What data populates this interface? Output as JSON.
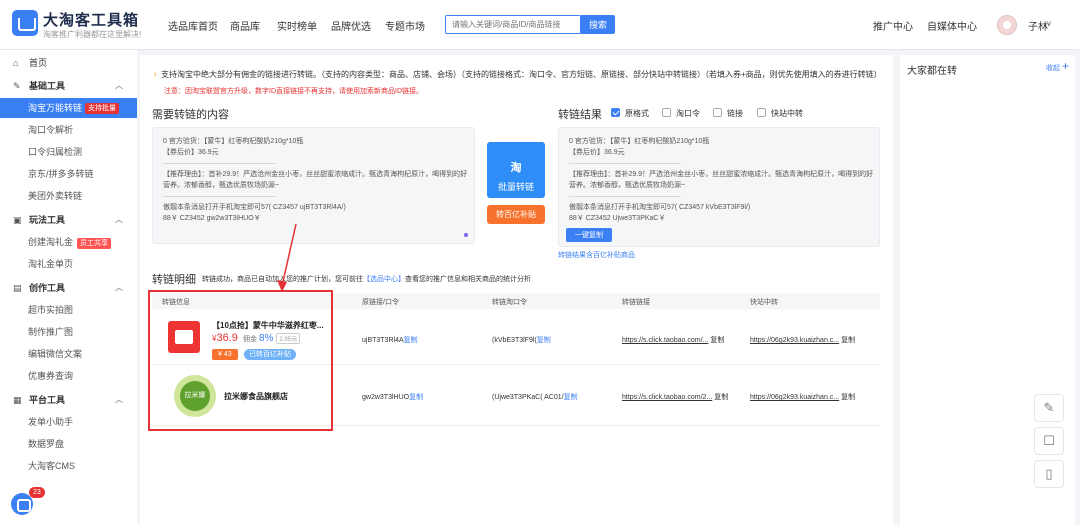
{
  "header": {
    "logo_title": "大淘客工具箱",
    "logo_subtitle": "淘客推广利器都在这里解决!",
    "nav": [
      "选品库首页",
      "商品库",
      "实时榜单",
      "品牌优选",
      "专题市场"
    ],
    "search_placeholder": "请输入关键词/商品ID/商品链接",
    "search_button": "搜索",
    "right_nav": [
      "推广中心",
      "自媒体中心"
    ],
    "username": "子林",
    "caret": "∨"
  },
  "sidebar": {
    "home": "首页",
    "sections": [
      {
        "title": "基础工具",
        "items": [
          {
            "label": "淘宝万能转链",
            "tag": "支持批量",
            "active": true
          },
          {
            "label": "淘口令解析"
          },
          {
            "label": "口令归属检测"
          },
          {
            "label": "京东/拼多多转链"
          },
          {
            "label": "美团外卖转链"
          }
        ]
      },
      {
        "title": "玩法工具",
        "items": [
          {
            "label": "创建淘礼金",
            "tag": "员工共享"
          },
          {
            "label": "淘礼金单页"
          }
        ]
      },
      {
        "title": "创作工具",
        "items": [
          {
            "label": "超市实拍图"
          },
          {
            "label": "制作推广图"
          },
          {
            "label": "编辑微信文案"
          },
          {
            "label": "优惠券查询"
          }
        ]
      },
      {
        "title": "平台工具",
        "items": [
          {
            "label": "发单小助手"
          },
          {
            "label": "数据罗盘"
          },
          {
            "label": "大淘客CMS"
          }
        ]
      }
    ],
    "assistant_badge": "23"
  },
  "main": {
    "notice": "支持淘宝中绝大部分有佣金的链接进行转链。（支持的内容类型：商品、店铺、会场）（支持的链接格式：淘口令、官方短链、原链接、部分快站中转链接）（若填入券+商品，则优先使用填入的券进行转链）",
    "warning": "注意：因淘宝联盟官方升级，数字ID直接链接不再支持，请使用加索新商品ID链接。",
    "input_title": "需要转链的内容",
    "input_lines": [
      "0 官方验货：【蒙牛】红枣枸杞酸奶210g*10瓶",
      "【券后价】36.9元",
      "————————————————",
      "【推荐理由】：首补29.9！严选沧州金丝小枣，丝丝甜蜜浓缩成汁。甄选青海枸杞原汁，喝得到的好",
      "营养。浓郁香醇，甄选优质牧场奶源~",
      "————————————————",
      "傲靓本条消息打开手机淘宝即可57( CZ3457 ujBT3T3Rl4A/)",
      "88￥ CZ3452 gw2w3T3lHUO￥"
    ],
    "convert_icon": "淘",
    "convert_button": "批量转链",
    "orange_button": "转百亿补贴",
    "result_title": "转链结果",
    "options": [
      {
        "label": "原格式",
        "checked": true
      },
      {
        "label": "淘口令",
        "checked": false
      },
      {
        "label": "链接",
        "checked": false
      },
      {
        "label": "快站中转",
        "checked": false
      }
    ],
    "result_lines": [
      "0 官方验货：【蒙牛】红枣枸杞酸奶210g*10瓶",
      "【券后价】36.9元",
      "————————————————",
      "【推荐理由】：首补29.9！严选沧州金丝小枣，丝丝甜蜜浓缩成汁。甄选青海枸杞原汁，喝得到的好",
      "营养。浓郁香醇，甄选优质牧场奶源~",
      "————————————————",
      "傲靓本条消息打开手机淘宝即可57( CZ3457 kVbE3T3lF9l/)",
      "88￥ CZ3452 Ujwe3T3PKaC￥"
    ],
    "copy_button": "一键复制",
    "result_link": "转链结果含百亿补贴商品",
    "detail_title": "转链明细",
    "detail_note_a": "转链成功，商品已自动加入您的推广计划，您可前往",
    "detail_note_link": "【选品中心】",
    "detail_note_b": "查看您的推广信息和相关商品的统计分析"
  },
  "table": {
    "headers": [
      "转链信息",
      "原链接/口令",
      "转链淘口令",
      "转链链接",
      "快站中转"
    ],
    "rows": [
      {
        "title": "【10点抢】蒙牛中华滋养红枣...",
        "price_prefix": "¥",
        "price": "36.9",
        "commission_label": "佣金",
        "commission": "8%",
        "original": "2.95元",
        "coupon": "¥ 43",
        "badge": "已转百亿补贴",
        "orig_code": "ujBT3T3Rl4A",
        "new_code": "(kVbE3T3lF9l(",
        "link": "https://s.click.taobao.com/...",
        "kuaizhan": "https://06g2k93.kuaizhan.c...",
        "copy": "复制"
      },
      {
        "shop_logo_text": "拉米娜",
        "shop": "拉米娜食品旗舰店",
        "orig_code": "gw2w3T3lHUO",
        "new_code": "(Ujwe3T3PKaC( AC01/",
        "link": "https://s.click.taobao.com/2...",
        "kuaizhan": "https://06g2k93.kuaizhan.c...",
        "copy": "复制"
      }
    ]
  },
  "right_panel": {
    "title": "大家都在转",
    "collapse": "收起",
    "plus": "+"
  },
  "colors": {
    "accent": "#3b7ff5",
    "warning": "#e63232",
    "orange": "#f7722d"
  }
}
